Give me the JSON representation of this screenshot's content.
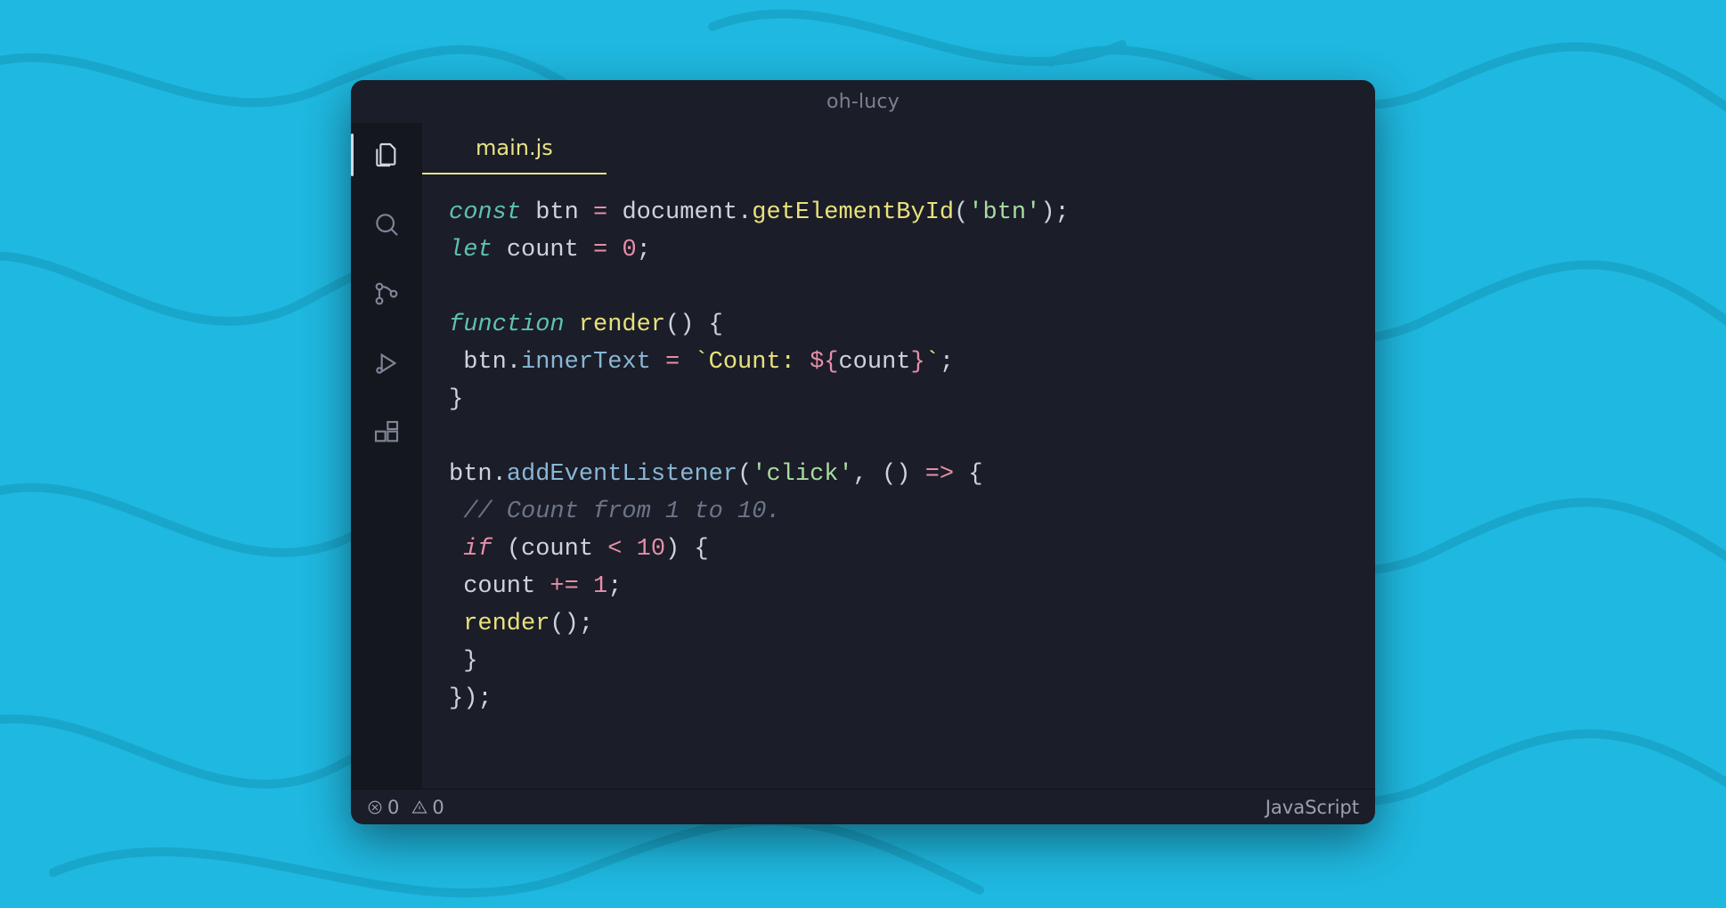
{
  "window": {
    "title": "oh-lucy"
  },
  "tabs": [
    {
      "label": "main.js",
      "active": true
    }
  ],
  "activitybar": {
    "items": [
      {
        "name": "files-icon",
        "active": true
      },
      {
        "name": "search-icon",
        "active": false
      },
      {
        "name": "source-control-icon",
        "active": false
      },
      {
        "name": "run-debug-icon",
        "active": false
      },
      {
        "name": "extensions-icon",
        "active": false
      }
    ]
  },
  "code": {
    "l1": {
      "kw": "const",
      "v1": "btn",
      "eq": "=",
      "obj": "document",
      "dot": ".",
      "fn": "getElementById",
      "lp": "(",
      "str": "'btn'",
      "rp": ")",
      "sc": ";"
    },
    "l2": {
      "kw": "let",
      "v1": "count",
      "eq": "=",
      "num": "0",
      "sc": ";"
    },
    "l4": {
      "kw": "function",
      "name": "render",
      "lp": "(",
      "rp": ")",
      "br": "{"
    },
    "l5": {
      "indent": " ",
      "obj": "btn",
      "dot": ".",
      "prop": "innerText",
      "eq": "=",
      "bt1": "`",
      "tmpl": "Count: ",
      "i_open": "${",
      "var": "count",
      "i_close": "}",
      "bt2": "`",
      "sc": ";"
    },
    "l6": {
      "br": "}"
    },
    "l8": {
      "obj": "btn",
      "dot": ".",
      "prop": "addEventListener",
      "lp": "(",
      "str": "'click'",
      "cm": ",",
      "sp": " ",
      "lp2": "(",
      "rp2": ")",
      "arrow": "=>",
      "br": "{"
    },
    "l9": {
      "indent": " ",
      "comment": "// Count from 1 to 10."
    },
    "l10": {
      "indent": " ",
      "kw": "if",
      "lp": "(",
      "v1": "count",
      "op": "<",
      "num": "10",
      "rp": ")",
      "br": "{"
    },
    "l11": {
      "indent": " ",
      "v1": "count",
      "op": "+=",
      "num": "1",
      "sc": ";"
    },
    "l12": {
      "indent": " ",
      "fn": "render",
      "lp": "(",
      "rp": ")",
      "sc": ";"
    },
    "l13": {
      "indent": " ",
      "br": "}"
    },
    "l14": {
      "br": "}",
      "rp": ")",
      "sc": ";"
    }
  },
  "statusbar": {
    "errors": "0",
    "warnings": "0",
    "language": "JavaScript"
  },
  "colors": {
    "background": "#1fb8e0",
    "editor_bg": "#1b1d28",
    "activitybar_bg": "#15171f",
    "tab_active_fg": "#e8e387",
    "keyword": "#5ec1b2",
    "string": "#a8dca0",
    "function": "#e9e17d",
    "property": "#89b7d6",
    "operator": "#e48fa8",
    "comment": "#6b7489",
    "foreground": "#cdd3dd"
  }
}
